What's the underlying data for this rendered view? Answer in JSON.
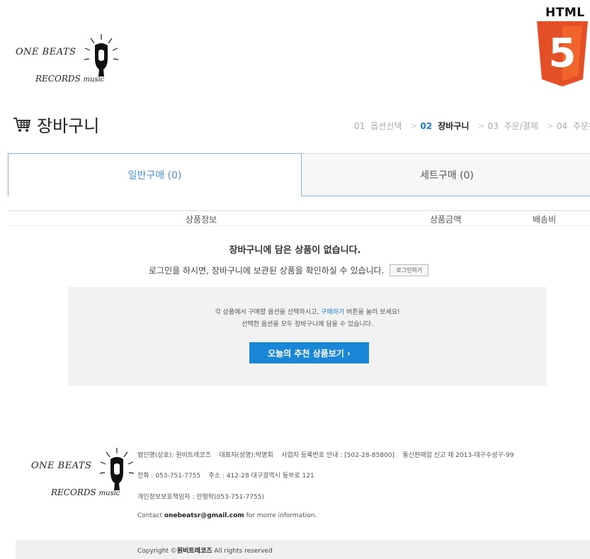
{
  "logo": {
    "line1": "ONE BEATS",
    "line2": "RECORDS",
    "line2_small": "music"
  },
  "badge": {
    "label": "HTML",
    "digit": "5",
    "colors": {
      "outer": "#e34f26",
      "inner": "#f06529",
      "digit": "#ffffff"
    }
  },
  "header": {
    "title": "장바구니",
    "steps": [
      {
        "num": "01",
        "label": "옵션선택"
      },
      {
        "num": "02",
        "label": "장바구니"
      },
      {
        "num": "03",
        "label": "주문/결제"
      },
      {
        "num": "04",
        "label": "주문완료"
      }
    ],
    "separator": ">"
  },
  "tabs": [
    {
      "label": "일반구매 (0)"
    },
    {
      "label": "세트구매 (0)"
    }
  ],
  "table": {
    "columns": [
      "상품정보",
      "상품금액",
      "배송비"
    ]
  },
  "empty": {
    "message": "장바구니에 담은 상품이 없습니다.",
    "login_message": "로그인을 하시면, 장바구니에 보관된 상품을 확인하실 수 있습니다.",
    "login_button": "로그인하기"
  },
  "recommend": {
    "line1_before": "각 상품에서 구매할 옵션을 선택하시고,",
    "line1_highlight": "구매하기",
    "line1_after": "버튼을 눌러 보세요!",
    "line2": "선택한 옵션을 모두 장바구니에 담을 수 있습니다.",
    "button": "오늘의 추천 상품보기 ›"
  },
  "footer": {
    "info1": "법인명(상호): 원비트레코즈    대표자(성명):박명회    사업자 등록번호 안내 : [502-28-85800]    통신판매업 신고 제 2013-대구수성구-99",
    "info2": "전화 : 053-751-7755    주소 : 412-28 대구광역시 동부로 121",
    "info3": "개인정보보호책임자 : 안형락(053-751-7755)",
    "contact_before": "Contact",
    "contact_email": "onebeatsr@gmail.com",
    "contact_after": "for morre information.",
    "copyright_before": "Copyright ©",
    "copyright_name": "원비트레코즈",
    "copyright_after": "All rights reserved"
  }
}
